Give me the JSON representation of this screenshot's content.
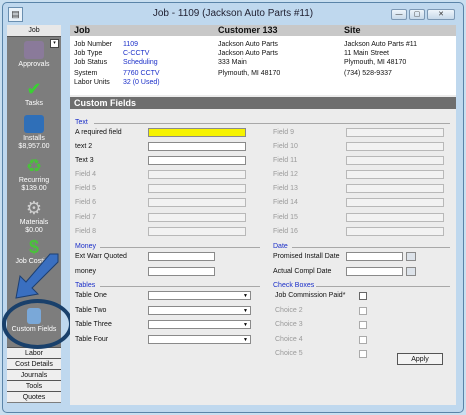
{
  "window": {
    "title": "Job - 1109 (Jackson Auto Parts #11)"
  },
  "sidebar": {
    "header": "Job",
    "items": [
      {
        "label": "Approvals",
        "icon": "approvals-icon",
        "color": "#8a7a9a"
      },
      {
        "label": "Tasks",
        "icon": "check-icon",
        "color": "#39a832"
      },
      {
        "label": "Installs",
        "sub": "$8,957.00",
        "icon": "installs-icon",
        "color": "#2f6fb8"
      },
      {
        "label": "Recurring",
        "sub": "$139.00",
        "icon": "recurring-icon",
        "color": "#3aa53a"
      },
      {
        "label": "Materials",
        "sub": "$0.00",
        "icon": "gear-icon",
        "color": "#9a9a9a"
      },
      {
        "label": "Job Costing",
        "icon": "dollar-icon",
        "color": "#3aa53a"
      },
      {
        "label": "Custom Fields",
        "icon": "custom-fields-icon",
        "color": "#7aa8d8"
      }
    ],
    "bottom": [
      "Labor",
      "Cost Details",
      "Journals",
      "Tools",
      "Quotes"
    ]
  },
  "header": {
    "job_title": "Job",
    "customer_title": "Customer 133",
    "site_title": "Site",
    "fields": [
      {
        "label": "Job Number",
        "value": "1109"
      },
      {
        "label": "Job Type",
        "value": "C-CCTV"
      },
      {
        "label": "Job Status",
        "value": "Scheduling"
      },
      {
        "label": "System",
        "value": "7760 CCTV"
      },
      {
        "label": "Labor Units",
        "value": "32 (0 Used)"
      }
    ],
    "customer": [
      "Jackson Auto Parts",
      "Jackson Auto Parts",
      "333 Main",
      "Plymouth, MI 48170"
    ],
    "site": [
      "Jackson Auto Parts #11",
      "11 Main Street",
      "Plymouth, MI 48170",
      "(734) 528-9337"
    ]
  },
  "custom_fields": {
    "title": "Custom Fields",
    "text_section": "Text",
    "text_left": [
      "A required field",
      "text 2",
      "Text 3",
      "Field 4",
      "Field 5",
      "Field 6",
      "Field 7",
      "Field 8"
    ],
    "text_right": [
      "Field 9",
      "Field 10",
      "Field 11",
      "Field 12",
      "Field 13",
      "Field 14",
      "Field 15",
      "Field 16"
    ],
    "money_section": "Money",
    "money": [
      "Ext Warr Quoted",
      "money"
    ],
    "date_section": "Date",
    "dates": [
      "Promised Install Date",
      "Actual Compl Date"
    ],
    "tables_section": "Tables",
    "tables": [
      "Table One",
      "Table Two",
      "Table Three",
      "Table  Four"
    ],
    "checkbox_section": "Check Boxes",
    "checkboxes": [
      "Job Commission Paid*",
      "Choice 2",
      "Choice 3",
      "Choice 4",
      "Choice 5"
    ],
    "apply_label": "Apply"
  },
  "colors": {
    "accent": "#1a2ec8",
    "required": "#f6f300",
    "callout": "#19406b"
  }
}
